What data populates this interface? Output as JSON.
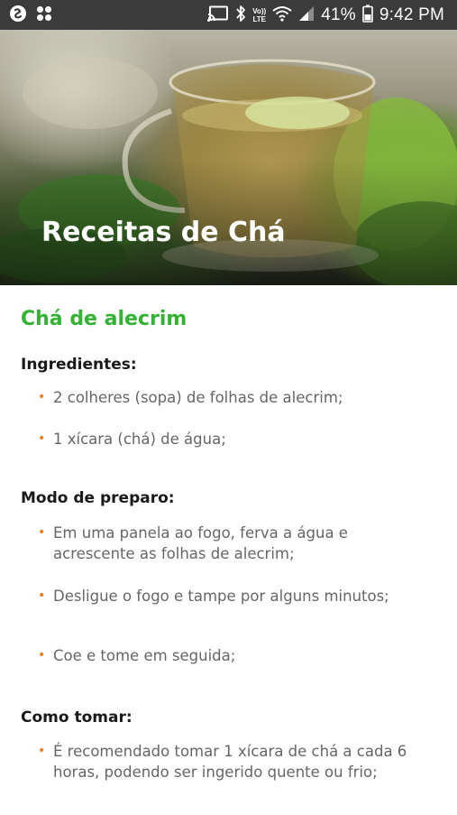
{
  "status_bar": {
    "left_icons": [
      "shazam-icon",
      "apps-grid-icon"
    ],
    "right_icons": [
      "cast-icon",
      "bluetooth-icon",
      "volte-icon",
      "wifi-icon",
      "signal-icon",
      "battery-icon"
    ],
    "volte_top": "Vo))",
    "volte_bottom": "LTE",
    "battery_percent": "41%",
    "time": "9:42 PM"
  },
  "hero": {
    "title": "Receitas de Chá"
  },
  "recipe": {
    "title": "Chá de alecrim",
    "sections": [
      {
        "heading": "Ingredientes:",
        "items": [
          "2 colheres (sopa) de folhas de alecrim;",
          "1 xícara (chá) de água;"
        ]
      },
      {
        "heading": "Modo de preparo:",
        "items": [
          "Em uma panela ao fogo, ferva a água e acrescente as folhas de alecrim;",
          "Desligue o fogo e tampe por alguns minutos;",
          "Coe e tome em seguida;"
        ]
      },
      {
        "heading": "Como tomar:",
        "items": [
          "É recomendado tomar 1 xícara de chá a cada 6 horas, podendo ser ingerido quente ou frio;"
        ]
      }
    ],
    "bullet": "•"
  },
  "colors": {
    "status_bar_bg": "#3b3b3b",
    "recipe_title": "#34b233",
    "bullet": "#e67e22",
    "body_text": "#666666",
    "heading_text": "#1a1a1a"
  }
}
